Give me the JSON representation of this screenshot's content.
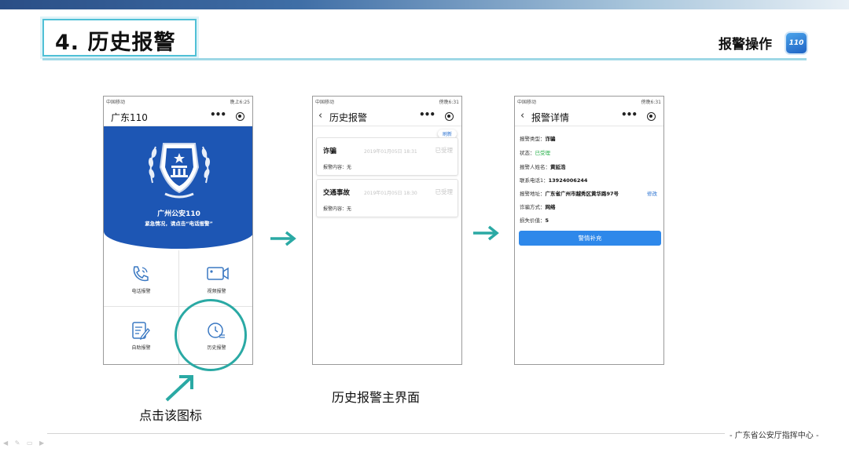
{
  "header": {
    "title": "4. 历史报警",
    "section": "报警操作",
    "badge": "110"
  },
  "screen1": {
    "status_left": "中国移动",
    "status_right": "晚上6:25",
    "nav_title": "广东110",
    "hero_title": "广州公安110",
    "hero_subtitle": "紧急情况，请点击“电话报警”",
    "tiles": [
      {
        "label": "电话报警"
      },
      {
        "label": "视频报警"
      },
      {
        "label": "自助报警"
      },
      {
        "label": "历史报警"
      }
    ]
  },
  "screen2": {
    "status_left": "中国移动",
    "status_right": "傍晚6:31",
    "nav_title": "历史报警",
    "refresh": "刷新",
    "records": [
      {
        "type": "诈骗",
        "date": "2019年01月05日 18:31",
        "status": "已受理",
        "content": "报警内容：无"
      },
      {
        "type": "交通事故",
        "date": "2019年01月05日 18:30",
        "status": "已受理",
        "content": "报警内容：无"
      }
    ]
  },
  "screen3": {
    "status_left": "中国移动",
    "status_right": "傍晚6:31",
    "nav_title": "报警详情",
    "fields": [
      {
        "label": "报警类型：",
        "value": "诈骗"
      },
      {
        "label": "状态：",
        "value": "已受理"
      },
      {
        "label": "报警人姓名：",
        "value": "黄延浩"
      },
      {
        "label": "联系电话1：",
        "value": "13924006244"
      },
      {
        "label": "报警地址：",
        "value": "广东省广州市越秀区黄华路97号"
      },
      {
        "label": "诈骗方式：",
        "value": "网络"
      },
      {
        "label": "损失价值：",
        "value": "5"
      }
    ],
    "edit": "修改",
    "supplement_button": "警情补充"
  },
  "captions": {
    "click_icon": "点击该图标",
    "history_main": "历史报警主界面"
  },
  "footer": {
    "org": "- 广东省公安厅指挥中心 -"
  },
  "colors": {
    "brand_blue": "#1d56b4",
    "teal_accent": "#2aa9a4",
    "status_green": "#27b04a",
    "button_blue": "#2e88ea"
  },
  "icons": [
    "phone-call-icon",
    "video-camera-icon",
    "form-edit-icon",
    "history-clock-icon",
    "police-emblem-icon",
    "back-chevron-icon",
    "more-dots-icon",
    "target-close-icon",
    "arrow-right-icon"
  ]
}
